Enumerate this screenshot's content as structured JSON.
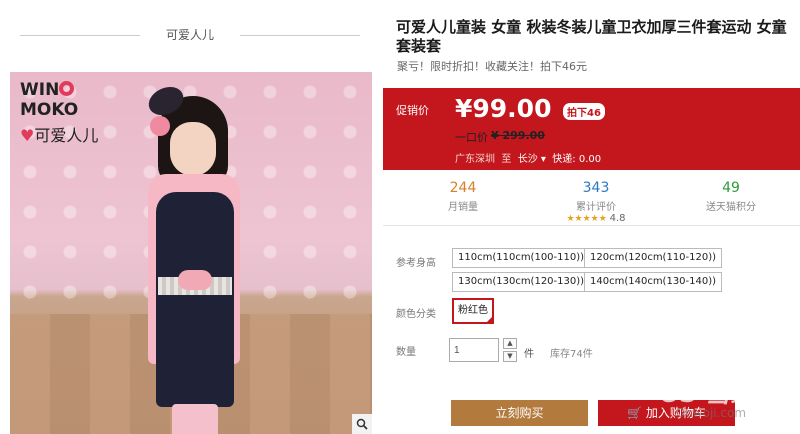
{
  "shop": {
    "name": "可爱人儿"
  },
  "photo": {
    "brand_logo_text": "WIN◎MOKO",
    "brand_sub": "可爱人儿"
  },
  "product": {
    "title": "可爱人儿童装 女童 秋装冬装儿童卫衣加厚三件套运动 女童套装套",
    "promo": "聚亏！限时折扣！收藏关注！拍下46元",
    "price_label": "促销价",
    "price": "¥99.00",
    "discount_tag": "拍下46",
    "original_label": "一口价",
    "original_price": "¥ 299.00",
    "ship_from": "广东深圳",
    "ship_to_word": "至",
    "ship_to": "长沙",
    "ship_fee": "快递: 0.00"
  },
  "stats": {
    "sales": {
      "value": "244",
      "label": "月销量"
    },
    "reviews": {
      "value": "343",
      "label": "累计评价",
      "rating": "4.8"
    },
    "points": {
      "value": "49",
      "label": "送天猫积分"
    }
  },
  "options": {
    "size_label": "参考身高",
    "sizes": [
      "110cm(110cm(100-110))",
      "120cm(120cm(110-120))",
      "130cm(130cm(120-130))",
      "140cm(140cm(130-140))"
    ],
    "color_label": "颜色分类",
    "colors": [
      "粉红色"
    ],
    "qty_label": "数量",
    "qty_value": "1",
    "qty_unit": "件",
    "stock": "库存74件"
  },
  "actions": {
    "buy_now": "立刻购买",
    "add_cart": "加入购物车"
  },
  "watermark": {
    "text": "OS 当家",
    "url": "Oowoji.com"
  },
  "colors": {
    "accent_red": "#c3161d",
    "buy_brown": "#b37a3e"
  }
}
